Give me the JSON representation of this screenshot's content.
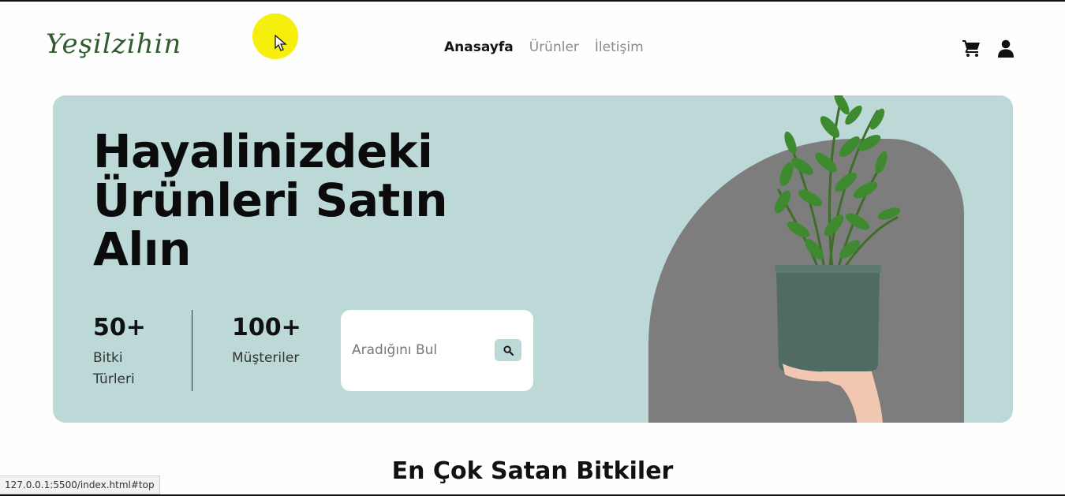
{
  "header": {
    "logo_text": "Yeşilzihin",
    "nav": [
      {
        "label": "Anasayfa",
        "active": true
      },
      {
        "label": "Ürünler",
        "active": false
      },
      {
        "label": "İletişim",
        "active": false
      }
    ],
    "icons": [
      "cart-icon",
      "user-icon"
    ]
  },
  "hero": {
    "title": "Hayalinizdeki Ürünleri Satın Alın",
    "stats": [
      {
        "value": "50+",
        "label": "Bitki Türleri"
      },
      {
        "value": "100+",
        "label": "Müşteriler"
      }
    ],
    "search": {
      "placeholder": "Aradığını Bul"
    },
    "colors": {
      "hero_bg": "#bcd9d8",
      "shape": "#7d7d7d",
      "pot": "#4f6b64"
    }
  },
  "section": {
    "heading": "En Çok Satan Bitkiler"
  },
  "status_bar": {
    "url": "127.0.0.1:5500/index.html#top"
  },
  "cursor": {
    "highlight_color": "#f6ef0c"
  }
}
